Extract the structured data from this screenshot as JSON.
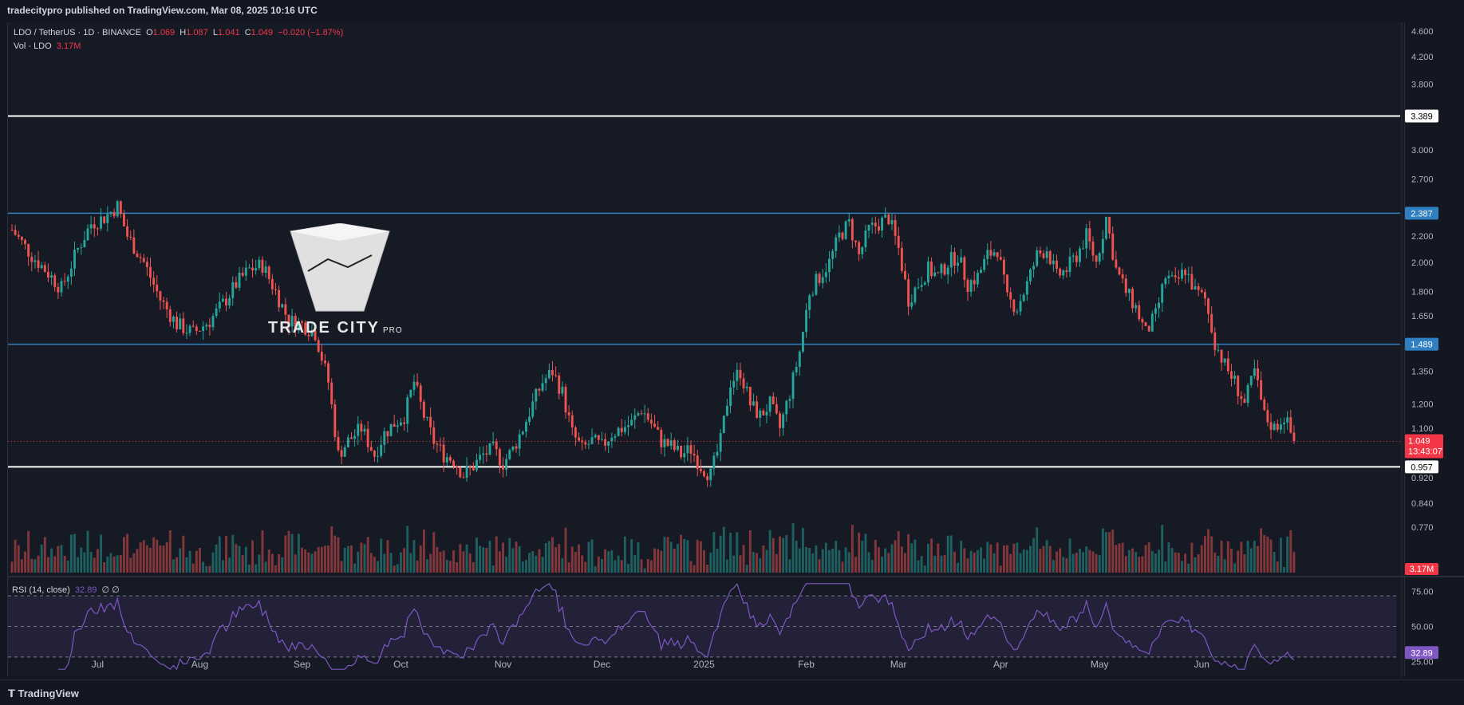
{
  "header": {
    "published": "tradecitypro published on TradingView.com, Mar 08, 2025 10:16 UTC"
  },
  "legend": {
    "symbol": "LDO / TetherUS · 1D · BINANCE",
    "o_label": "O",
    "o": "1.069",
    "h_label": "H",
    "h": "1.087",
    "l_label": "L",
    "l": "1.041",
    "c_label": "C",
    "c": "1.049",
    "change": "−0.020 (−1.87%)",
    "vol_label": "Vol · LDO",
    "vol": "3.17M"
  },
  "rsi_legend": {
    "label": "RSI (14, close)",
    "value": "32.89",
    "extra": "∅ ∅"
  },
  "watermark": {
    "name": "TRADE CITY",
    "suffix": "PRO"
  },
  "footer": {
    "brand": "TradingView"
  },
  "colors": {
    "up": "#26a69a",
    "down": "#ef5350",
    "level_white": "#ffffff",
    "level_blue": "#2962ff",
    "rsi": "#7e57c2",
    "price_label": "#f23645"
  },
  "chart_data": {
    "type": "candlestick",
    "symbol": "LDO / TetherUS",
    "interval": "1D",
    "y_scale": "log",
    "ylim": [
      0.7,
      4.75
    ],
    "y_ticks": [
      "4.600",
      "4.200",
      "3.800",
      "3.000",
      "2.700",
      "2.200",
      "2.000",
      "1.800",
      "1.650",
      "1.350",
      "1.200",
      "1.100",
      "0.920",
      "0.840",
      "0.770"
    ],
    "x_ticks": [
      "Jul",
      "Aug",
      "Sep",
      "Oct",
      "Nov",
      "Dec",
      "2025",
      "Feb",
      "Mar",
      "Apr",
      "May",
      "Jun"
    ],
    "horizontal_levels": [
      {
        "value": 3.389,
        "label": "3.389",
        "color": "white"
      },
      {
        "value": 2.387,
        "label": "2.387",
        "color": "blue"
      },
      {
        "value": 1.489,
        "label": "1.489",
        "color": "blue"
      },
      {
        "value": 0.957,
        "label": "0.957",
        "color": "white"
      }
    ],
    "last_price": {
      "value": 1.049,
      "label": "1.049",
      "countdown": "13:43:07"
    },
    "volume_label": "3.17M",
    "rsi": {
      "period": 14,
      "levels": [
        "75.00",
        "50.00",
        "25.00"
      ],
      "last": "32.89"
    },
    "close_path": [
      [
        0,
        2.25
      ],
      [
        6,
        2.05
      ],
      [
        10,
        1.95
      ],
      [
        15,
        1.82
      ],
      [
        20,
        2.1
      ],
      [
        24,
        2.3
      ],
      [
        28,
        2.35
      ],
      [
        32,
        2.45
      ],
      [
        35,
        2.2
      ],
      [
        40,
        2.0
      ],
      [
        45,
        1.75
      ],
      [
        50,
        1.6
      ],
      [
        55,
        1.55
      ],
      [
        60,
        1.62
      ],
      [
        65,
        1.75
      ],
      [
        68,
        1.85
      ],
      [
        72,
        1.95
      ],
      [
        76,
        1.98
      ],
      [
        80,
        1.8
      ],
      [
        84,
        1.62
      ],
      [
        88,
        1.6
      ],
      [
        92,
        1.55
      ],
      [
        96,
        1.3
      ],
      [
        99,
        1.0
      ],
      [
        102,
        1.05
      ],
      [
        106,
        1.1
      ],
      [
        110,
        1.0
      ],
      [
        113,
        1.08
      ],
      [
        116,
        1.12
      ],
      [
        119,
        1.15
      ],
      [
        122,
        1.3
      ],
      [
        125,
        1.15
      ],
      [
        128,
        1.05
      ],
      [
        131,
        1.0
      ],
      [
        134,
        0.98
      ],
      [
        137,
        0.93
      ],
      [
        140,
        0.96
      ],
      [
        143,
        1.0
      ],
      [
        146,
        1.02
      ],
      [
        149,
        0.97
      ],
      [
        152,
        1.02
      ],
      [
        155,
        1.1
      ],
      [
        158,
        1.2
      ],
      [
        161,
        1.3
      ],
      [
        164,
        1.35
      ],
      [
        167,
        1.25
      ],
      [
        170,
        1.08
      ],
      [
        173,
        1.02
      ],
      [
        176,
        1.05
      ],
      [
        179,
        1.03
      ],
      [
        182,
        1.08
      ],
      [
        185,
        1.1
      ],
      [
        188,
        1.12
      ],
      [
        191,
        1.18
      ],
      [
        194,
        1.12
      ],
      [
        197,
        1.05
      ],
      [
        200,
        1.03
      ],
      [
        203,
        1.0
      ],
      [
        206,
        1.02
      ],
      [
        209,
        0.96
      ],
      [
        212,
        0.93
      ],
      [
        215,
        1.05
      ],
      [
        218,
        1.3
      ],
      [
        221,
        1.35
      ],
      [
        224,
        1.2
      ],
      [
        227,
        1.15
      ],
      [
        230,
        1.2
      ],
      [
        233,
        1.1
      ],
      [
        236,
        1.25
      ],
      [
        239,
        1.45
      ],
      [
        242,
        1.8
      ],
      [
        245,
        1.9
      ],
      [
        248,
        2.0
      ],
      [
        251,
        2.2
      ],
      [
        254,
        2.3
      ],
      [
        257,
        2.05
      ],
      [
        260,
        2.25
      ],
      [
        263,
        2.3
      ],
      [
        266,
        2.35
      ],
      [
        269,
        2.1
      ],
      [
        272,
        1.75
      ],
      [
        275,
        1.85
      ],
      [
        278,
        1.95
      ],
      [
        281,
        1.9
      ],
      [
        284,
        2.0
      ],
      [
        287,
        2.05
      ],
      [
        290,
        1.85
      ],
      [
        293,
        1.9
      ],
      [
        296,
        2.05
      ],
      [
        299,
        2.1
      ],
      [
        302,
        1.75
      ],
      [
        305,
        1.7
      ],
      [
        308,
        1.85
      ],
      [
        311,
        2.05
      ],
      [
        314,
        2.1
      ],
      [
        317,
        1.9
      ],
      [
        320,
        1.95
      ],
      [
        323,
        2.05
      ],
      [
        326,
        2.2
      ],
      [
        329,
        2.0
      ],
      [
        332,
        2.35
      ],
      [
        335,
        1.95
      ],
      [
        338,
        1.8
      ],
      [
        341,
        1.7
      ],
      [
        344,
        1.55
      ],
      [
        347,
        1.65
      ],
      [
        350,
        1.9
      ],
      [
        353,
        1.85
      ],
      [
        356,
        1.95
      ],
      [
        359,
        1.8
      ],
      [
        362,
        1.75
      ],
      [
        365,
        1.5
      ],
      [
        368,
        1.38
      ],
      [
        371,
        1.3
      ],
      [
        374,
        1.2
      ],
      [
        377,
        1.35
      ],
      [
        380,
        1.15
      ],
      [
        383,
        1.1
      ],
      [
        386,
        1.15
      ],
      [
        389,
        1.05
      ]
    ]
  }
}
